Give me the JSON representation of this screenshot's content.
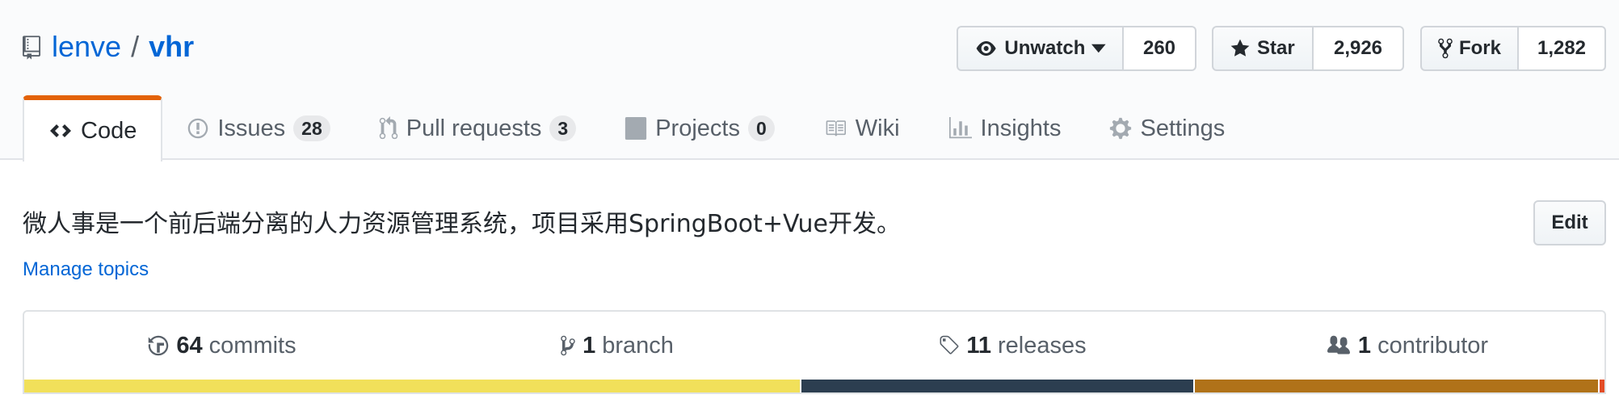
{
  "repo": {
    "owner": "lenve",
    "separator": "/",
    "name": "vhr"
  },
  "actions": {
    "watch": {
      "label": "Unwatch",
      "count": "260"
    },
    "star": {
      "label": "Star",
      "count": "2,926"
    },
    "fork": {
      "label": "Fork",
      "count": "1,282"
    }
  },
  "tabs": [
    {
      "label": "Code",
      "icon": "code-icon",
      "selected": true
    },
    {
      "label": "Issues",
      "icon": "issue-icon",
      "counter": "28"
    },
    {
      "label": "Pull requests",
      "icon": "pull-request-icon",
      "counter": "3"
    },
    {
      "label": "Projects",
      "icon": "project-icon",
      "counter": "0"
    },
    {
      "label": "Wiki",
      "icon": "book-icon"
    },
    {
      "label": "Insights",
      "icon": "graph-icon"
    },
    {
      "label": "Settings",
      "icon": "gear-icon"
    }
  ],
  "description": "微人事是一个前后端分离的人力资源管理系统，项目采用SpringBoot+Vue开发。",
  "edit_label": "Edit",
  "manage_topics": "Manage topics",
  "summary": {
    "commits": {
      "count": "64",
      "label": "commits"
    },
    "branches": {
      "count": "1",
      "label": "branch"
    },
    "releases": {
      "count": "11",
      "label": "releases"
    },
    "contributors": {
      "count": "1",
      "label": "contributor"
    }
  },
  "languages": [
    {
      "color": "#f1e05a",
      "percent": 49.1
    },
    {
      "color": "#2c3e50",
      "percent": 24.9
    },
    {
      "color": "#b07219",
      "percent": 25.6
    },
    {
      "color": "#e34c26",
      "percent": 0.4
    }
  ]
}
